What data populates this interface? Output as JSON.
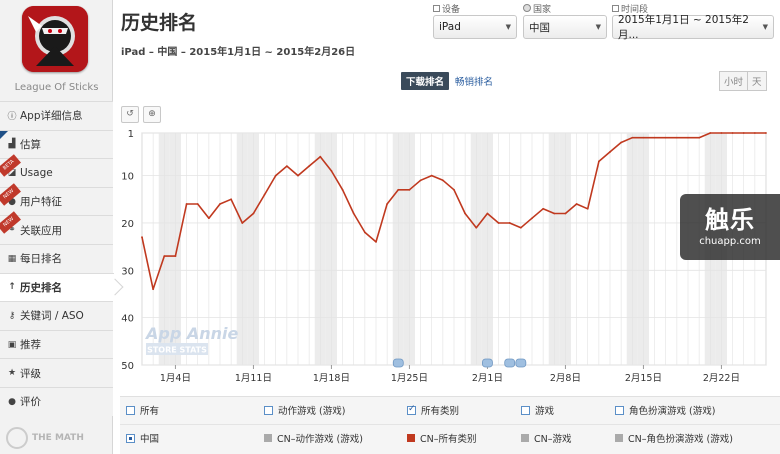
{
  "app": {
    "name": "League Of Sticks"
  },
  "sidebar": {
    "items": [
      {
        "label": "App详细信息",
        "icon": "info-icon",
        "badge": ""
      },
      {
        "label": "估算",
        "icon": "chart-icon",
        "badge": ""
      },
      {
        "label": "Usage",
        "icon": "usage-icon",
        "badge": "BETA"
      },
      {
        "label": "用户特征",
        "icon": "users-icon",
        "badge": "NEW"
      },
      {
        "label": "关联应用",
        "icon": "link-icon",
        "badge": "NEW"
      },
      {
        "label": "每日排名",
        "icon": "calendar-icon",
        "badge": ""
      },
      {
        "label": "历史排名",
        "icon": "arrow-up-icon",
        "badge": ""
      },
      {
        "label": "关键词 / ASO",
        "icon": "key-icon",
        "badge": ""
      },
      {
        "label": "推荐",
        "icon": "feature-icon",
        "badge": ""
      },
      {
        "label": "评级",
        "icon": "star-icon",
        "badge": ""
      },
      {
        "label": "评价",
        "icon": "comment-icon",
        "badge": ""
      }
    ],
    "footer": "THE MATH"
  },
  "header": {
    "title": "历史排名",
    "subtitle": "iPad – 中国 – 2015年1月1日 ~ 2015年2月26日"
  },
  "filters": {
    "device": {
      "label": "设备",
      "value": "iPad"
    },
    "country": {
      "label": "国家",
      "value": "中国"
    },
    "period": {
      "label": "时间段",
      "value": "2015年1月1日 ~ 2015年2月..."
    }
  },
  "tabs": {
    "active": "下载排名",
    "other": "畅销排名"
  },
  "granularity": {
    "hour": "小时",
    "day": "天"
  },
  "watermark": {
    "brand": "App Annie",
    "sub": "STORE STATS"
  },
  "overlay": {
    "big": "触乐",
    "small": "chuapp.com"
  },
  "chart_data": {
    "type": "line",
    "title": "",
    "xlabel": "",
    "ylabel": "",
    "y_reversed": true,
    "ylim": [
      1,
      50
    ],
    "yticks": [
      1,
      10,
      20,
      30,
      40,
      50
    ],
    "xticks": [
      "1月4日",
      "1月11日",
      "1月18日",
      "1月25日",
      "2月1日",
      "2月8日",
      "2月15日",
      "2月22日"
    ],
    "series": [
      {
        "name": "CN–所有类别",
        "color": "#c0391f",
        "x": [
          "2015-01-01",
          "2015-01-02",
          "2015-01-03",
          "2015-01-04",
          "2015-01-05",
          "2015-01-06",
          "2015-01-07",
          "2015-01-08",
          "2015-01-09",
          "2015-01-10",
          "2015-01-11",
          "2015-01-12",
          "2015-01-13",
          "2015-01-14",
          "2015-01-15",
          "2015-01-16",
          "2015-01-17",
          "2015-01-18",
          "2015-01-19",
          "2015-01-20",
          "2015-01-21",
          "2015-01-22",
          "2015-01-23",
          "2015-01-24",
          "2015-01-25",
          "2015-01-26",
          "2015-01-27",
          "2015-01-28",
          "2015-01-29",
          "2015-01-30",
          "2015-01-31",
          "2015-02-01",
          "2015-02-02",
          "2015-02-03",
          "2015-02-04",
          "2015-02-05",
          "2015-02-06",
          "2015-02-07",
          "2015-02-08",
          "2015-02-09",
          "2015-02-10",
          "2015-02-11",
          "2015-02-12",
          "2015-02-13",
          "2015-02-14",
          "2015-02-15",
          "2015-02-16",
          "2015-02-17",
          "2015-02-18",
          "2015-02-19",
          "2015-02-20",
          "2015-02-21",
          "2015-02-22",
          "2015-02-23",
          "2015-02-24",
          "2015-02-25",
          "2015-02-26"
        ],
        "values": [
          23,
          34,
          27,
          27,
          16,
          16,
          19,
          16,
          15,
          20,
          18,
          14,
          10,
          8,
          10,
          8,
          6,
          9,
          13,
          18,
          22,
          24,
          16,
          13,
          13,
          11,
          10,
          11,
          13,
          18,
          21,
          18,
          20,
          20,
          21,
          19,
          17,
          18,
          18,
          16,
          17,
          7,
          5,
          3,
          2,
          2,
          2,
          2,
          2,
          2,
          2,
          1,
          1,
          1,
          1,
          1,
          1
        ]
      }
    ]
  },
  "legend": {
    "row1": [
      {
        "label": "所有",
        "checked": false
      },
      {
        "label": "动作游戏 (游戏)",
        "checked": false
      },
      {
        "label": "所有类别",
        "checked": true
      },
      {
        "label": "游戏",
        "checked": false
      },
      {
        "label": "角色扮演游戏 (游戏)",
        "checked": false
      }
    ],
    "row2": [
      {
        "label": "中国",
        "kind": "radio",
        "color": ""
      },
      {
        "label": "CN–动作游戏 (游戏)",
        "kind": "swatch",
        "color": "#aaaaaa"
      },
      {
        "label": "CN–所有类别",
        "kind": "swatch",
        "color": "#c0391f"
      },
      {
        "label": "CN–游戏",
        "kind": "swatch",
        "color": "#aaaaaa"
      },
      {
        "label": "CN–角色扮演游戏 (游戏)",
        "kind": "swatch",
        "color": "#aaaaaa"
      }
    ]
  }
}
